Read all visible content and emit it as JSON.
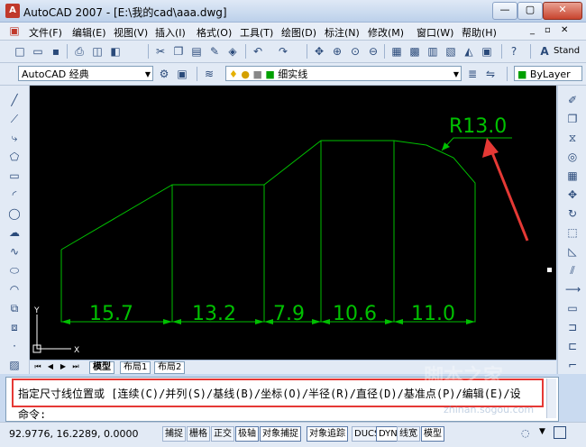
{
  "window": {
    "title": "AutoCAD 2007 - [E:\\我的cad\\aaa.dwg]",
    "minimize": "—",
    "restore": "▢",
    "close": "✕"
  },
  "menu": {
    "items": [
      "文件(F)",
      "编辑(E)",
      "视图(V)",
      "插入(I)",
      "格式(O)",
      "工具(T)",
      "绘图(D)",
      "标注(N)",
      "修改(M)",
      "窗口(W)",
      "帮助(H)"
    ]
  },
  "toolbar1": {
    "text_style": "Stand"
  },
  "toolbar2": {
    "workspace": "AutoCAD 经典",
    "layer": "细实线",
    "color": "ByLayer"
  },
  "drawing": {
    "radius_label": "R13.0",
    "dims": [
      "15.7",
      "13.2",
      "7.9",
      "10.6",
      "11.0"
    ],
    "ucs_x": "X",
    "ucs_y": "Y"
  },
  "tabs": {
    "items": [
      "模型",
      "布局1",
      "布局2"
    ]
  },
  "command": {
    "line1": "指定尺寸线位置或 [连续(C)/并列(S)/基线(B)/坐标(O)/半径(R)/直径(D)/基准点(P)/编辑(E)/设",
    "line2": "命令:"
  },
  "status": {
    "coords": "92.9776, 16.2289, 0.0000",
    "buttons": [
      "捕捉",
      "栅格",
      "正交",
      "极轴",
      "对象捕捉",
      "对象追踪",
      "DUCS",
      "DYN",
      "线宽",
      "模型"
    ]
  },
  "watermark": {
    "text": "脚本之家",
    "url": "zhinan.sogou.com"
  },
  "colors": {
    "drawing_lines": "#00c000",
    "annotation": "#e53935",
    "canvas": "#000000"
  }
}
